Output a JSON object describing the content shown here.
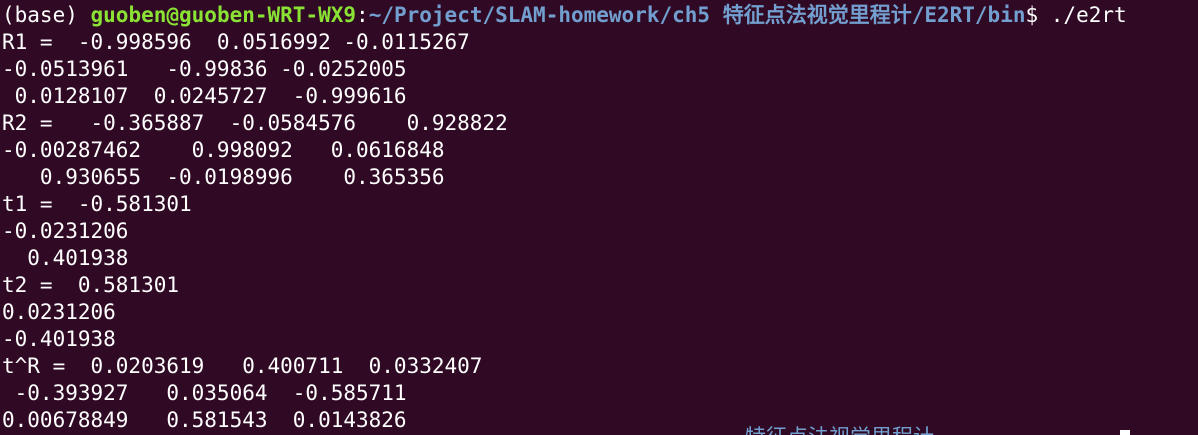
{
  "prompt": {
    "env": "(base) ",
    "user_host": "guoben@guoben-WRT-WX9",
    "separator": ":",
    "path": "~/Project/SLAM-homework/ch5 特征点法视觉里程计/E2RT/bin",
    "symbol": "$ ",
    "command": "./e2rt"
  },
  "output_lines": [
    "R1 =  -0.998596  0.0516992 -0.0115267",
    "-0.0513961   -0.99836 -0.0252005",
    " 0.0128107  0.0245727  -0.999616",
    "R2 =   -0.365887  -0.0584576    0.928822",
    "-0.00287462    0.998092   0.0616848",
    "   0.930655  -0.0198996    0.365356",
    "t1 =  -0.581301",
    "-0.0231206",
    "  0.401938",
    "t2 =  0.581301",
    "0.0231206",
    "-0.401938",
    "t^R =  0.0203619   0.400711  0.0332407",
    " -0.393927   0.035064  -0.585711",
    "0.00678849   0.581543  0.0143826"
  ],
  "ghost_text": "特征点法视觉里程计",
  "colors": {
    "background": "#300a24",
    "user_host": "#8ae234",
    "path": "#729fcf",
    "text": "#ffffff"
  }
}
